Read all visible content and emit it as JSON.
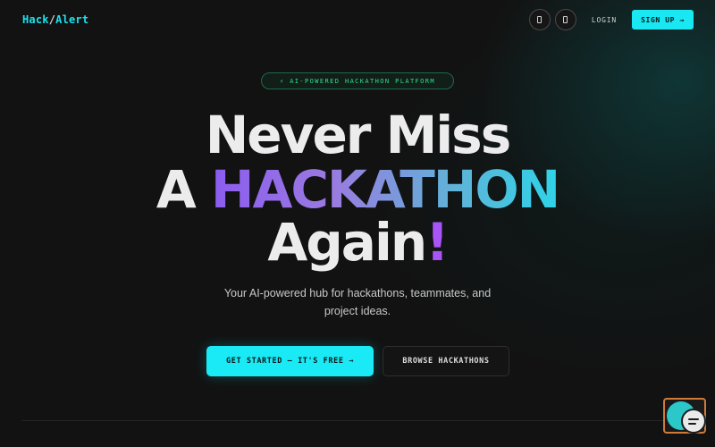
{
  "nav": {
    "logo_part1": "Hack",
    "logo_slash": "/",
    "logo_part2": "Alert",
    "icon_buttons": [
      "device-icon",
      "device-icon"
    ],
    "login_label": "LOGIN",
    "signup_label": "SIGN UP →"
  },
  "hero": {
    "badge": "⚡ AI-POWERED HACKATHON PLATFORM",
    "line1": "Never Miss",
    "line2_prefix": "A ",
    "line2_highlight": "HACKATHON",
    "line3_text": "Again",
    "line3_accent": "!",
    "subtitle": "Your AI-powered hub for hackathons, teammates, and project ideas."
  },
  "cta": {
    "primary_label": "GET STARTED — IT'S FREE →",
    "secondary_label": "BROWSE HACKATHONS"
  },
  "colors": {
    "accent_cyan": "#19e8f3",
    "accent_green": "#2fe08a",
    "accent_purple": "#a855f7",
    "background": "#121212"
  },
  "widgets": {
    "chat_icon": "chat-bubble-icon"
  }
}
